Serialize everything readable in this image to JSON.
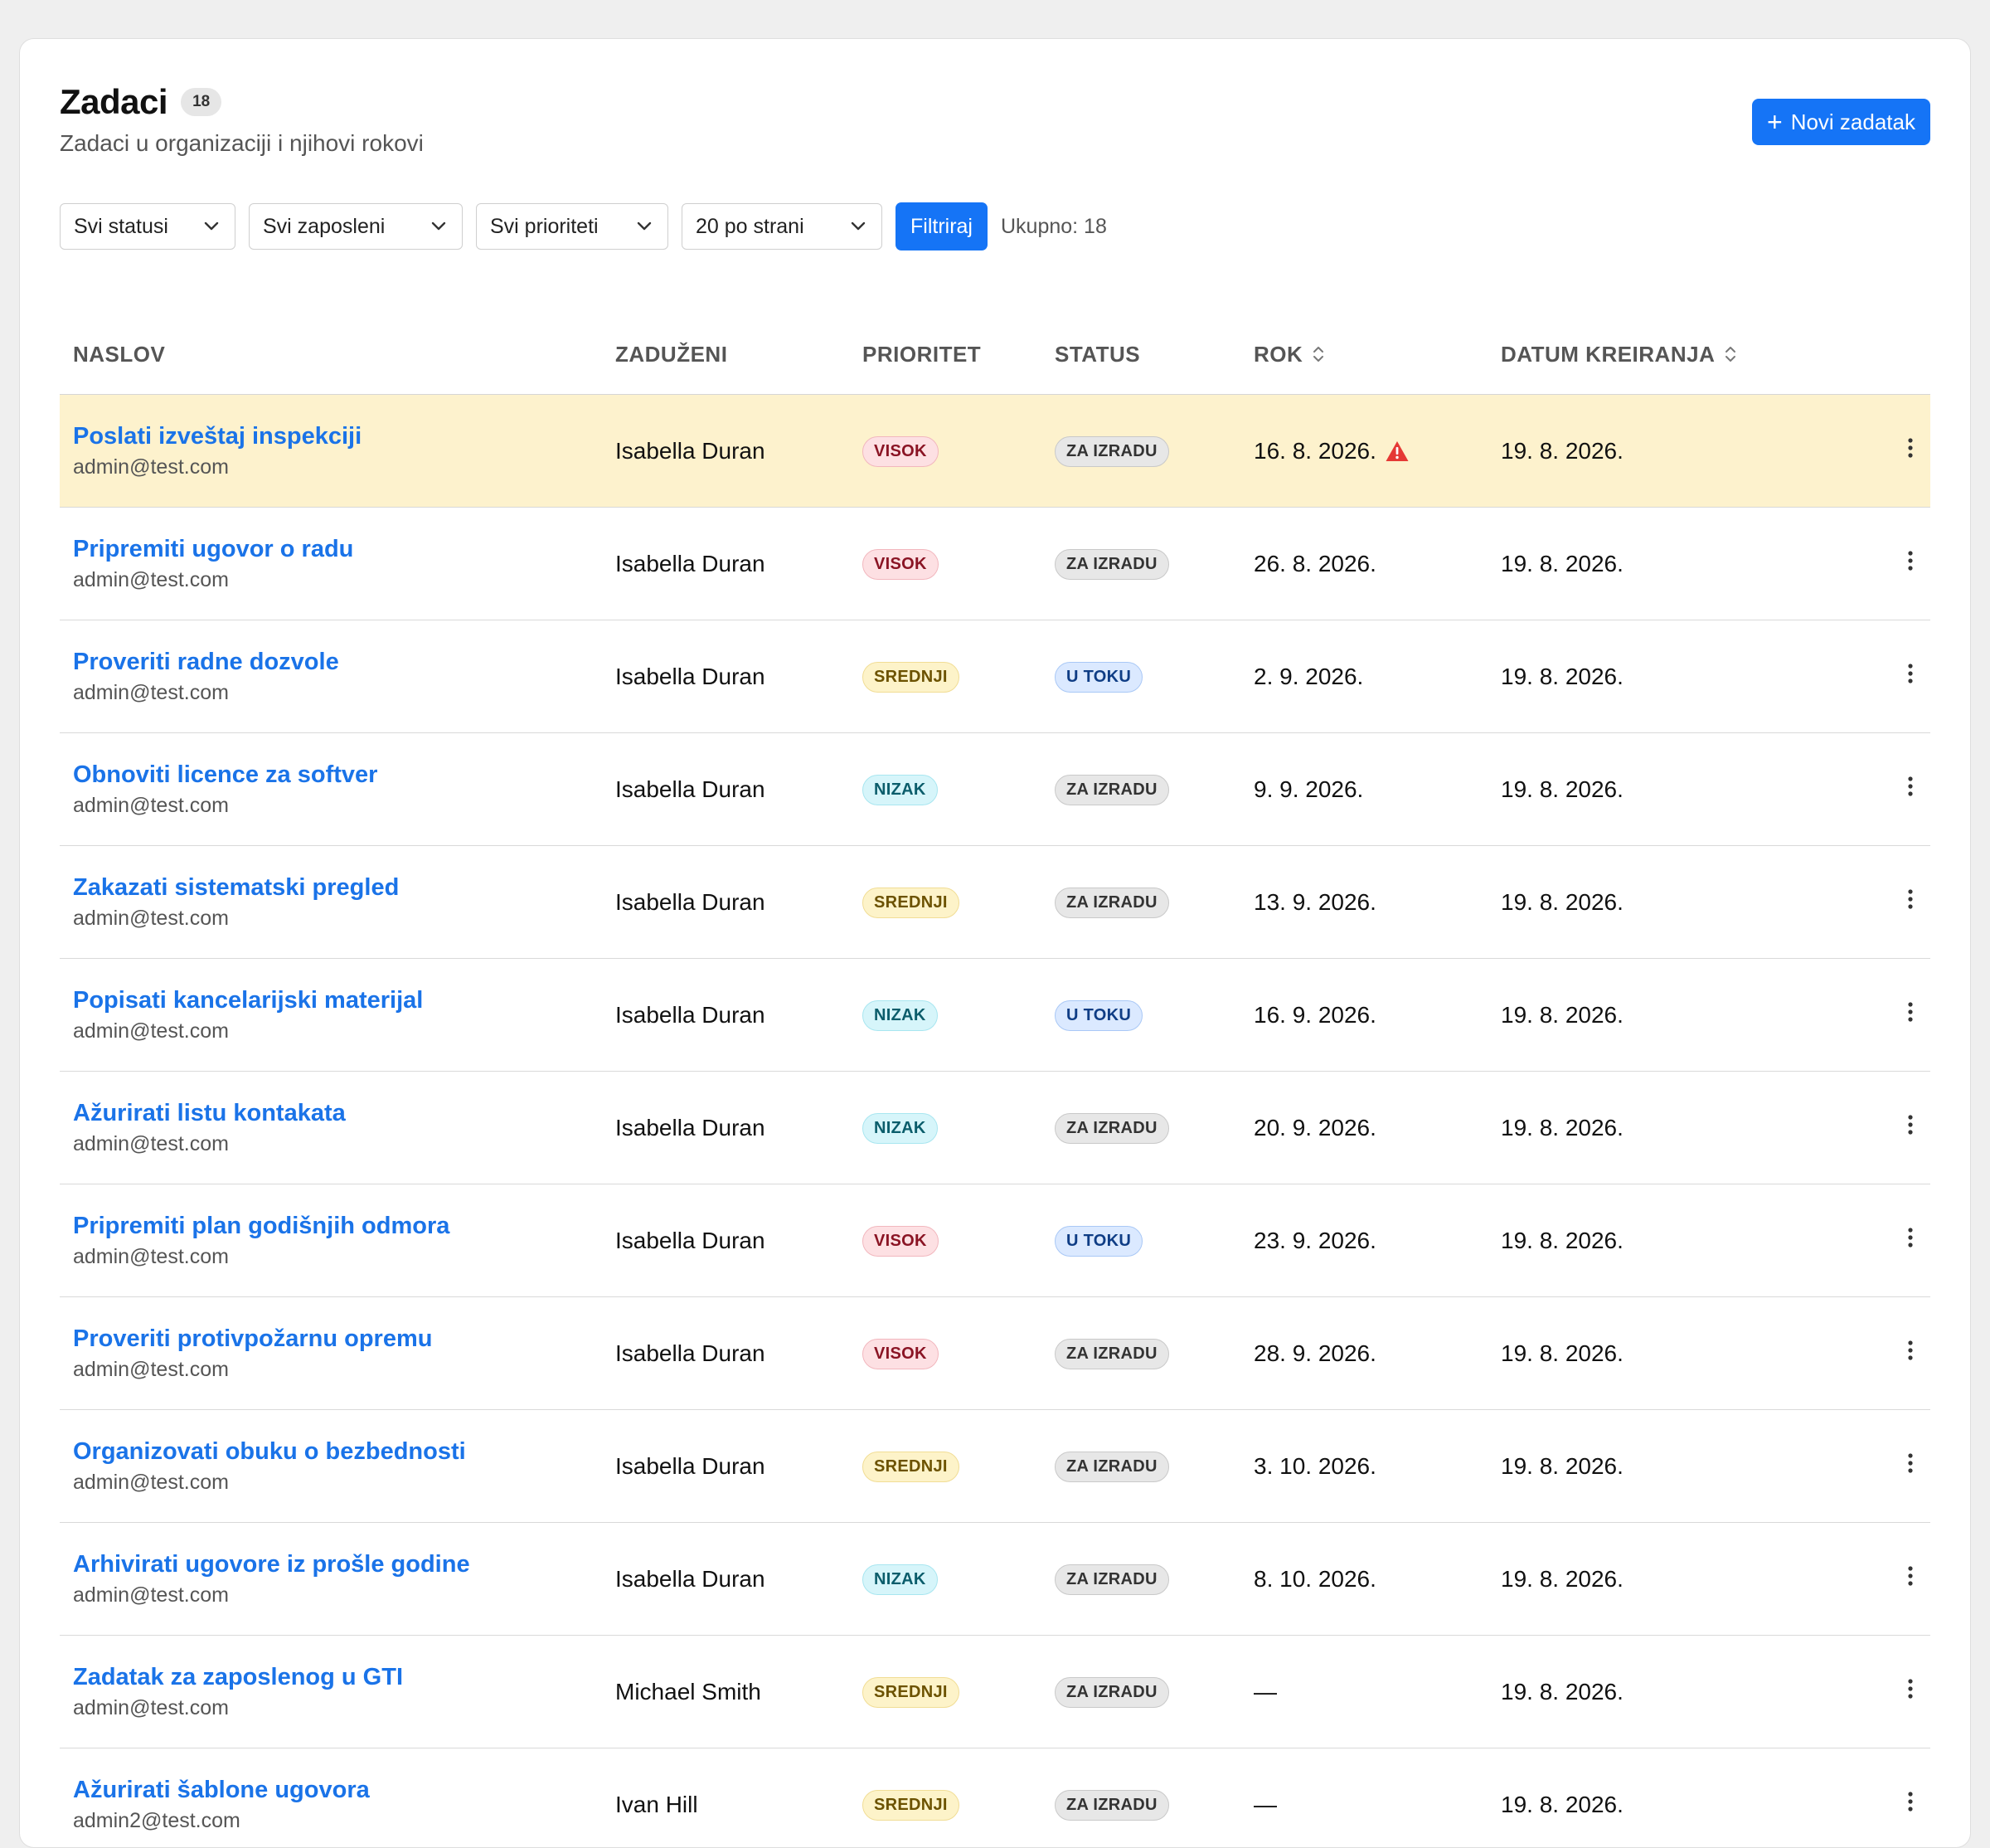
{
  "header": {
    "title": "Zadaci",
    "count": "18",
    "subtitle": "Zadaci u organizaciji i njihovi rokovi",
    "new_button_label": "Novi zadatak"
  },
  "filters": {
    "status": "Svi statusi",
    "employees": "Svi zaposleni",
    "priorities": "Svi prioriteti",
    "per_page": "20 po strani",
    "filter_button": "Filtriraj",
    "total": "Ukupno: 18"
  },
  "table": {
    "columns": {
      "title": "NASLOV",
      "assignee": "ZADUŽENI",
      "priority": "PRIORITET",
      "status": "STATUS",
      "due": "ROK",
      "created": "DATUM KREIRANJA"
    },
    "rows": [
      {
        "title": "Poslati izveštaj inspekciji",
        "email": "admin@test.com",
        "assignee": "Isabella Duran",
        "priority": "VISOK",
        "status": "ZA IZRADU",
        "due": "16. 8. 2026.",
        "created": "19. 8. 2026.",
        "overdue": true
      },
      {
        "title": "Pripremiti ugovor o radu",
        "email": "admin@test.com",
        "assignee": "Isabella Duran",
        "priority": "VISOK",
        "status": "ZA IZRADU",
        "due": "26. 8. 2026.",
        "created": "19. 8. 2026."
      },
      {
        "title": "Proveriti radne dozvole",
        "email": "admin@test.com",
        "assignee": "Isabella Duran",
        "priority": "SREDNJI",
        "status": "U TOKU",
        "due": "2. 9. 2026.",
        "created": "19. 8. 2026."
      },
      {
        "title": "Obnoviti licence za softver",
        "email": "admin@test.com",
        "assignee": "Isabella Duran",
        "priority": "NIZAK",
        "status": "ZA IZRADU",
        "due": "9. 9. 2026.",
        "created": "19. 8. 2026."
      },
      {
        "title": "Zakazati sistematski pregled",
        "email": "admin@test.com",
        "assignee": "Isabella Duran",
        "priority": "SREDNJI",
        "status": "ZA IZRADU",
        "due": "13. 9. 2026.",
        "created": "19. 8. 2026."
      },
      {
        "title": "Popisati kancelarijski materijal",
        "email": "admin@test.com",
        "assignee": "Isabella Duran",
        "priority": "NIZAK",
        "status": "U TOKU",
        "due": "16. 9. 2026.",
        "created": "19. 8. 2026."
      },
      {
        "title": "Ažurirati listu kontakata",
        "email": "admin@test.com",
        "assignee": "Isabella Duran",
        "priority": "NIZAK",
        "status": "ZA IZRADU",
        "due": "20. 9. 2026.",
        "created": "19. 8. 2026."
      },
      {
        "title": "Pripremiti plan godišnjih odmora",
        "email": "admin@test.com",
        "assignee": "Isabella Duran",
        "priority": "VISOK",
        "status": "U TOKU",
        "due": "23. 9. 2026.",
        "created": "19. 8. 2026."
      },
      {
        "title": "Proveriti protivpožarnu opremu",
        "email": "admin@test.com",
        "assignee": "Isabella Duran",
        "priority": "VISOK",
        "status": "ZA IZRADU",
        "due": "28. 9. 2026.",
        "created": "19. 8. 2026."
      },
      {
        "title": "Organizovati obuku o bezbednosti",
        "email": "admin@test.com",
        "assignee": "Isabella Duran",
        "priority": "SREDNJI",
        "status": "ZA IZRADU",
        "due": "3. 10. 2026.",
        "created": "19. 8. 2026."
      },
      {
        "title": "Arhivirati ugovore iz prošle godine",
        "email": "admin@test.com",
        "assignee": "Isabella Duran",
        "priority": "NIZAK",
        "status": "ZA IZRADU",
        "due": "8. 10. 2026.",
        "created": "19. 8. 2026."
      },
      {
        "title": "Zadatak za zaposlenog u GTI",
        "email": "admin@test.com",
        "assignee": "Michael Smith",
        "priority": "SREDNJI",
        "status": "ZA IZRADU",
        "due": "—",
        "created": "19. 8. 2026."
      },
      {
        "title": "Ažurirati šablone ugovora",
        "email": "admin2@test.com",
        "assignee": "Ivan Hill",
        "priority": "SREDNJI",
        "status": "ZA IZRADU",
        "due": "—",
        "created": "19. 8. 2026."
      }
    ]
  },
  "icons": {
    "plus": "plus-icon",
    "chevron": "chevron-down-icon",
    "sort": "sort-icon",
    "warning": "warning-icon",
    "more": "more-vertical-icon"
  },
  "colors": {
    "accent": "#1574f6",
    "link": "#1a73e8",
    "highlight_row": "#fdf2cd",
    "warning": "#e53935"
  }
}
